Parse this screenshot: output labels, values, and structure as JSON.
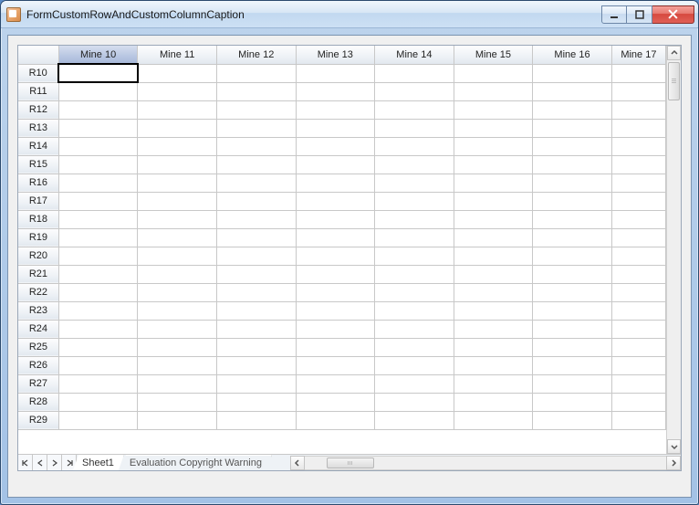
{
  "window": {
    "title": "FormCustomRowAndCustomColumnCaption"
  },
  "grid": {
    "columns": [
      "Mine 10",
      "Mine 11",
      "Mine 12",
      "Mine 13",
      "Mine 14",
      "Mine 15",
      "Mine 16",
      "Mine 17"
    ],
    "rows": [
      "R10",
      "R11",
      "R12",
      "R13",
      "R14",
      "R15",
      "R16",
      "R17",
      "R18",
      "R19",
      "R20",
      "R21",
      "R22",
      "R23",
      "R24",
      "R25",
      "R26",
      "R27",
      "R28",
      "R29"
    ],
    "selected_column_index": 0,
    "active_cell": {
      "row": 0,
      "col": 0
    }
  },
  "tabs": {
    "active": "Sheet1",
    "items": [
      "Sheet1",
      "Evaluation Copyright Warning"
    ]
  }
}
